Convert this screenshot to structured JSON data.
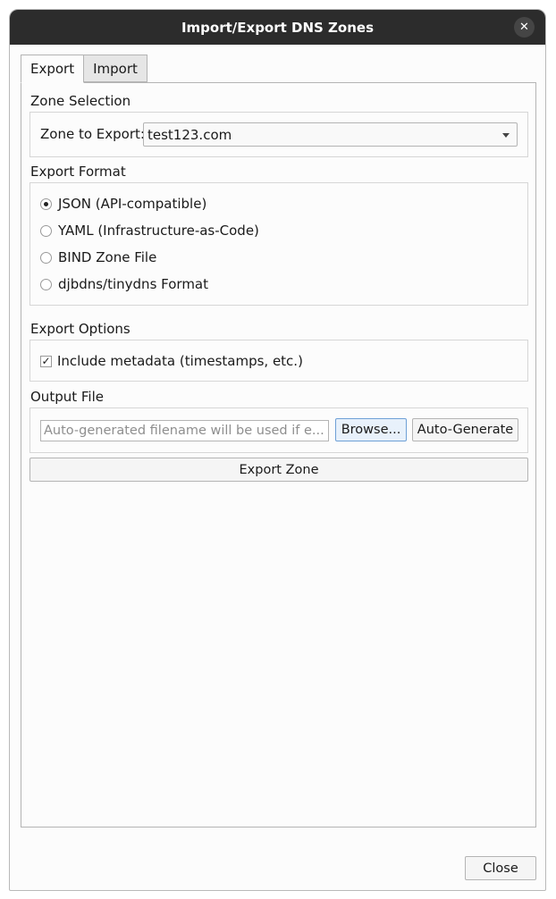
{
  "window": {
    "title": "Import/Export DNS Zones",
    "close_glyph": "✕"
  },
  "tabs": [
    {
      "label": "Export"
    },
    {
      "label": "Import"
    }
  ],
  "zone_selection": {
    "title": "Zone Selection",
    "label": "Zone to Export:",
    "selected": "test123.com"
  },
  "export_format": {
    "title": "Export Format",
    "options": [
      {
        "label": "JSON (API-compatible)",
        "checked": true
      },
      {
        "label": "YAML (Infrastructure-as-Code)",
        "checked": false
      },
      {
        "label": "BIND Zone File",
        "checked": false
      },
      {
        "label": "djbdns/tinydns Format",
        "checked": false
      }
    ]
  },
  "export_options": {
    "title": "Export Options",
    "include_metadata": {
      "label": "Include metadata (timestamps, etc.)",
      "checked": true
    }
  },
  "output_file": {
    "title": "Output File",
    "value": "",
    "placeholder": "Auto-generated filename will be used if e...",
    "browse_label": "Browse...",
    "autogen_label": "Auto-Generate"
  },
  "export_button_label": "Export Zone",
  "close_button_label": "Close"
}
